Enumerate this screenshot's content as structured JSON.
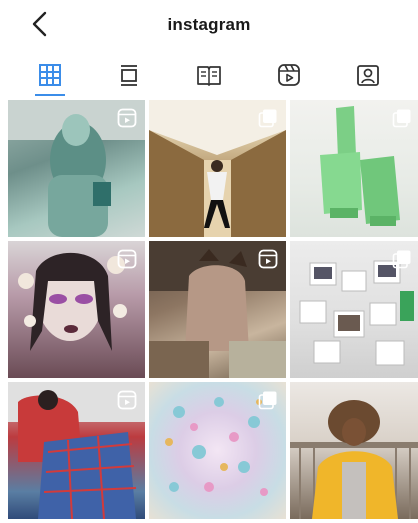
{
  "header": {
    "title": "instagram",
    "back_icon": "chevron-left-icon"
  },
  "tabs": [
    {
      "name": "grid",
      "icon": "grid-icon",
      "active": true,
      "color": "#3b8de9"
    },
    {
      "name": "feed",
      "icon": "feed-icon",
      "active": false
    },
    {
      "name": "guides",
      "icon": "guides-icon",
      "active": false
    },
    {
      "name": "reels",
      "icon": "reels-icon",
      "active": false
    },
    {
      "name": "tagged",
      "icon": "tagged-icon",
      "active": false
    }
  ],
  "posts": [
    {
      "badge": "reels-badge-icon"
    },
    {
      "badge": "carousel-badge-icon"
    },
    {
      "badge": "carousel-badge-icon"
    },
    {
      "badge": "reels-badge-icon"
    },
    {
      "badge": "reels-badge-icon"
    },
    {
      "badge": "carousel-badge-icon"
    },
    {
      "badge": "reels-badge-icon"
    },
    {
      "badge": "carousel-badge-icon"
    },
    {
      "badge": "none"
    }
  ],
  "colors": {
    "accent": "#3b8de9",
    "icon": "#222222"
  }
}
